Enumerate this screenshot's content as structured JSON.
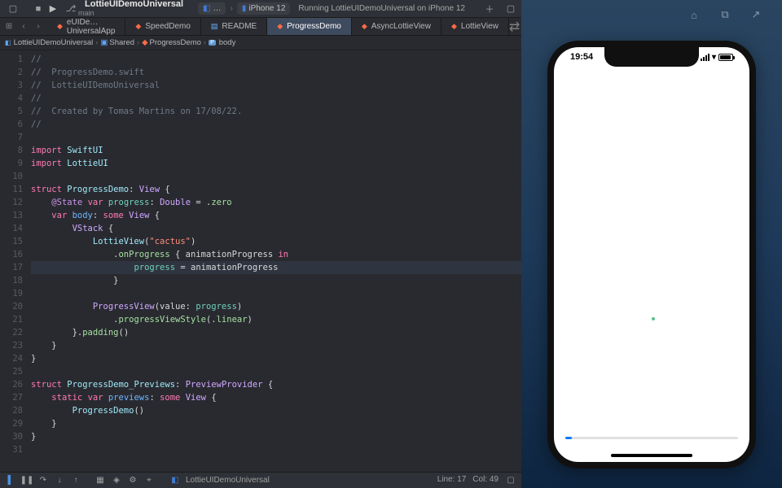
{
  "toolbar": {
    "project_title": "LottieUIDemoUniversal",
    "project_branch": "main",
    "scheme": "…",
    "destination": "iPhone 12",
    "status": "Running LottieUIDemoUniversal on iPhone 12"
  },
  "tabs": [
    {
      "label": "eUIDe…UniversalApp",
      "icon": "swift"
    },
    {
      "label": "SpeedDemo",
      "icon": "swift"
    },
    {
      "label": "README",
      "icon": "md"
    },
    {
      "label": "ProgressDemo",
      "icon": "swift",
      "active": true
    },
    {
      "label": "AsyncLottieView",
      "icon": "swift"
    },
    {
      "label": "LottieView",
      "icon": "swift"
    }
  ],
  "breadcrumb": {
    "project": "LottieUIDemoUniversal",
    "folder": "Shared",
    "file": "ProgressDemo",
    "symbol_kind": "P",
    "symbol": "body"
  },
  "code_lines": [
    {
      "n": 1,
      "html": "<span class='cm'>//</span>"
    },
    {
      "n": 2,
      "html": "<span class='cm'>//  ProgressDemo.swift</span>"
    },
    {
      "n": 3,
      "html": "<span class='cm'>//  LottieUIDemoUniversal</span>"
    },
    {
      "n": 4,
      "html": "<span class='cm'>//</span>"
    },
    {
      "n": 5,
      "html": "<span class='cm'>//  Created by Tomas Martins on 17/08/22.</span>"
    },
    {
      "n": 6,
      "html": "<span class='cm'>//</span>"
    },
    {
      "n": 7,
      "html": ""
    },
    {
      "n": 8,
      "html": "<span class='kw'>import</span> <span class='ty'>SwiftUI</span>"
    },
    {
      "n": 9,
      "html": "<span class='kw'>import</span> <span class='ty'>LottieUI</span>"
    },
    {
      "n": 10,
      "html": ""
    },
    {
      "n": 11,
      "html": "<span class='kw'>struct</span> <span class='ty'>ProgressDemo</span><span class='pu'>:</span> <span class='xc'>View</span> <span class='pu'>{</span>"
    },
    {
      "n": 12,
      "html": "    <span class='at'>@State</span> <span class='kw'>var</span> <span class='id-teal'>progress</span><span class='pu'>:</span> <span class='xc'>Double</span> <span class='pu'>=</span> <span class='pu'>.</span><span class='en'>zero</span>"
    },
    {
      "n": 13,
      "html": "    <span class='kw'>var</span> <span class='id-blue'>body</span><span class='pu'>:</span> <span class='kw'>some</span> <span class='xc'>View</span> <span class='pu'>{</span>"
    },
    {
      "n": 14,
      "html": "        <span class='xc'>VStack</span> <span class='pu'>{</span>"
    },
    {
      "n": 15,
      "html": "            <span class='ty'>LottieView</span><span class='pu'>(</span><span class='st'>\"cactus\"</span><span class='pu'>)</span>"
    },
    {
      "n": 16,
      "html": "                <span class='pu'>.</span><span class='fn'>onProgress</span> <span class='pu'>{</span> animationProgress <span class='kw'>in</span>"
    },
    {
      "n": 17,
      "html": "                    <span class='id-teal'>progress</span> <span class='pu'>=</span> animationProgress",
      "hl": true
    },
    {
      "n": 18,
      "html": "                <span class='pu'>}</span>"
    },
    {
      "n": 19,
      "html": ""
    },
    {
      "n": 20,
      "html": "            <span class='xc'>ProgressView</span><span class='pu'>(</span>value<span class='pu'>:</span> <span class='id-teal'>progress</span><span class='pu'>)</span>"
    },
    {
      "n": 21,
      "html": "                <span class='pu'>.</span><span class='fn'>progressViewStyle</span><span class='pu'>(.</span><span class='en'>linear</span><span class='pu'>)</span>"
    },
    {
      "n": 22,
      "html": "        <span class='pu'>}.</span><span class='fn'>padding</span><span class='pu'>()</span>"
    },
    {
      "n": 23,
      "html": "    <span class='pu'>}</span>"
    },
    {
      "n": 24,
      "html": "<span class='pu'>}</span>"
    },
    {
      "n": 25,
      "html": ""
    },
    {
      "n": 26,
      "html": "<span class='kw'>struct</span> <span class='ty'>ProgressDemo_Previews</span><span class='pu'>:</span> <span class='xc'>PreviewProvider</span> <span class='pu'>{</span>"
    },
    {
      "n": 27,
      "html": "    <span class='kw'>static</span> <span class='kw'>var</span> <span class='id-blue'>previews</span><span class='pu'>:</span> <span class='kw'>some</span> <span class='xc'>View</span> <span class='pu'>{</span>"
    },
    {
      "n": 28,
      "html": "        <span class='ty'>ProgressDemo</span><span class='pu'>()</span>"
    },
    {
      "n": 29,
      "html": "    <span class='pu'>}</span>"
    },
    {
      "n": 30,
      "html": "<span class='pu'>}</span>"
    },
    {
      "n": 31,
      "html": ""
    }
  ],
  "bottom": {
    "scheme": "LottieUIDemoUniversal",
    "line_label": "Line:",
    "line": "17",
    "col_label": "Col:",
    "col": "49"
  },
  "simulator": {
    "time": "19:54"
  }
}
